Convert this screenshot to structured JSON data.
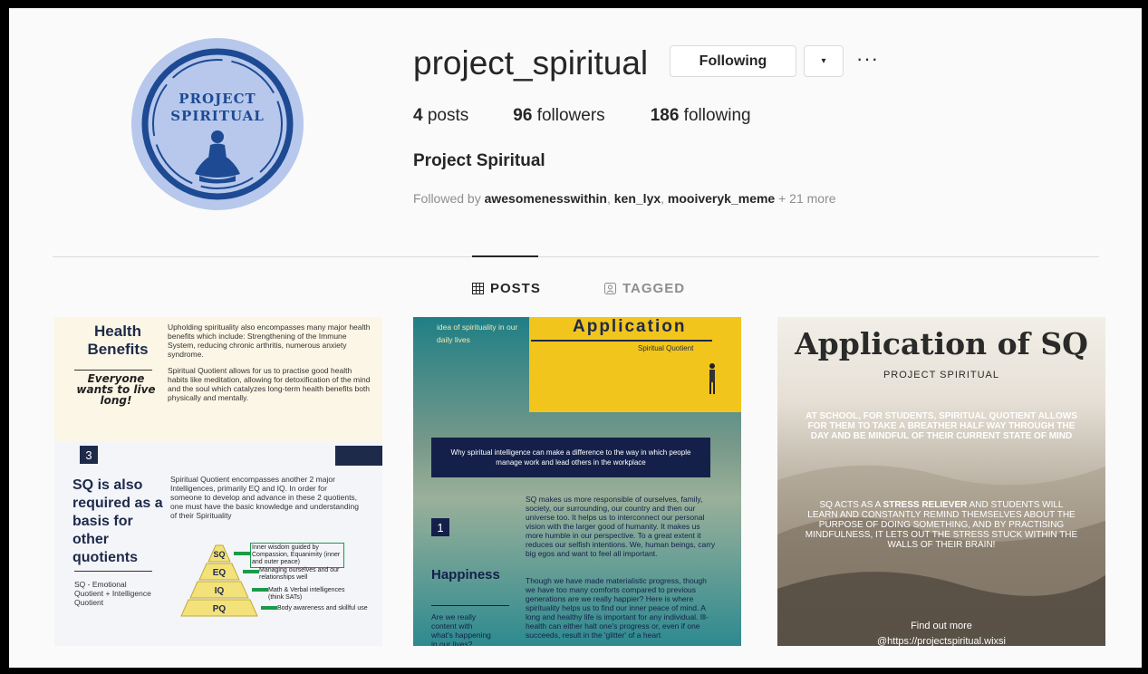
{
  "profile": {
    "username": "project_spiritual",
    "follow_button": "Following",
    "dropdown_icon": "▾",
    "more_icon": "···",
    "stats": {
      "posts_count": "4",
      "posts_label": "posts",
      "followers_count": "96",
      "followers_label": "followers",
      "following_count": "186",
      "following_label": "following"
    },
    "full_name": "Project Spiritual",
    "followed_by": {
      "prefix": "Followed by",
      "user1": "awesomenesswithin",
      "user2": "ken_lyx",
      "user3": "mooiveryk_meme",
      "suffix": "+ 21 more"
    },
    "avatar_line1": "PROJECT",
    "avatar_line2": "SPIRITUAL"
  },
  "tabs": {
    "posts": "POSTS",
    "tagged": "TAGGED"
  },
  "posts": {
    "p1": {
      "title1": "Health",
      "title2": "Benefits",
      "para1": "Upholding spirituality also encompasses many major health benefits which include: Strengthening of the Immune System, reducing chronic arthritis, numerous anxiety syndrome.",
      "quote": "Everyone wants to live long!",
      "para2": "Spiritual Quotient allows for us to practise good health habits like meditation, allowing for detoxification of the mind and the soul which catalyzes long-term health benefits both physically and mentally.",
      "number": "3",
      "heading": "SQ is also required as a basis for other quotients",
      "para3": "Spiritual Quotient encompasses another 2 major Intelligences, primarily EQ and IQ. In order for someone to develop and advance in these 2 quotients, one must have the basic knowledge and understanding of their Spirituality",
      "legend": "SQ - Emotional Quotient + Intelligence Quotient",
      "pyramid": [
        "SQ",
        "EQ",
        "IQ",
        "PQ"
      ],
      "notes": [
        "Inner wisdom guided by Compassion, Equanimity (inner and outer peace)",
        "Managing ourselves and our relationships well",
        "Math & Verbal intelligences (think SATs)",
        "Body awareness and skillful use"
      ]
    },
    "p2": {
      "side_text": "idea of spirituality in our daily lives",
      "title": "Application",
      "subtitle": "Spiritual Quotient",
      "banner": "Why spiritual intelligence can make a difference to the way in which people manage work and lead others in the workplace",
      "number": "1",
      "heading": "Happiness",
      "body1": "SQ makes us more responsible of ourselves, family, society, our surrounding, our country and then our universe too. It helps us to interconnect our personal vision with the larger good of humanity. It makes us more humble in our perspective. To a great extent it reduces our selfish intentions. We, human beings, carry big egos and want to feel all important.",
      "side2": "Are we really content with what's happening in our lives?",
      "body2": "Though we have made materialistic progress, though we have too many comforts compared to previous generations are we really happier? Here is where spirituality helps us to find our inner peace of mind. A long and healthy life is important for any individual. Ill-health can either halt one's progress or, even if one succeeds, result in the 'glitter' of a heart"
    },
    "p3": {
      "title": "Application of SQ",
      "subtitle": "PROJECT SPIRITUAL",
      "para1": "AT SCHOOL, FOR STUDENTS, SPIRITUAL QUOTIENT ALLOWS FOR THEM TO TAKE A BREATHER HALF WAY THROUGH THE DAY AND BE MINDFUL OF THEIR CURRENT STATE OF MIND",
      "para2_a": "SQ ACTS AS A",
      "para2_bold": "STRESS RELIEVER",
      "para2_b": "AND STUDENTS WILL LEARN AND CONSTANTLY REMIND THEMSELVES ABOUT THE PURPOSE OF DOING SOMETHING, AND BY PRACTISING MINDFULNESS, IT LETS OUT THE STRESS STUCK WITHIN THE WALLS OF THEIR BRAIN!",
      "footer1": "Find out more",
      "footer2": "@https://projectspiritual.wixsi"
    }
  }
}
